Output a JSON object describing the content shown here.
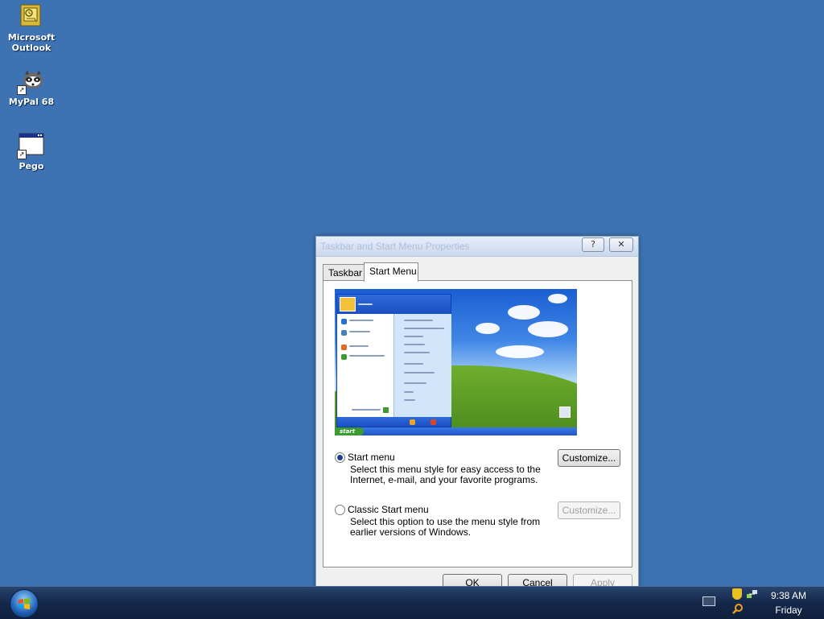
{
  "desktop": {
    "icons": [
      {
        "label_line1": "Microsoft",
        "label_line2": "Outlook"
      },
      {
        "label_line1": "MyPal 68"
      },
      {
        "label_line1": "Pego"
      }
    ]
  },
  "dialog": {
    "title": "Taskbar and Start Menu Properties",
    "help_label": "?",
    "close_label": "✕",
    "tabs": [
      {
        "label": "Taskbar"
      },
      {
        "label": "Start Menu",
        "active": true
      }
    ],
    "preview": {
      "start_label": "start"
    },
    "options": [
      {
        "label": "Start menu",
        "description_line1": "Select this menu style for easy access to the",
        "description_line2": "Internet, e-mail, and your favorite programs.",
        "selected": true,
        "customize_label": "Customize...",
        "customize_enabled": true
      },
      {
        "label": "Classic Start menu",
        "description_line1": "Select this option to use the menu style from",
        "description_line2": "earlier versions of Windows.",
        "selected": false,
        "customize_label": "Customize...",
        "customize_enabled": false
      }
    ],
    "buttons": {
      "ok": "OK",
      "cancel": "Cancel",
      "apply": "Apply"
    }
  },
  "taskbar": {
    "clock_time": "9:38 AM",
    "clock_day": "Friday",
    "tray_icons": [
      "keyboard-icon",
      "shield-icon",
      "network-icon",
      "search-icon"
    ]
  },
  "colors": {
    "desktop_bg": "#3d73b3",
    "taskbar_bg": "#15284a",
    "radio_dot": "#1a3f8c"
  }
}
